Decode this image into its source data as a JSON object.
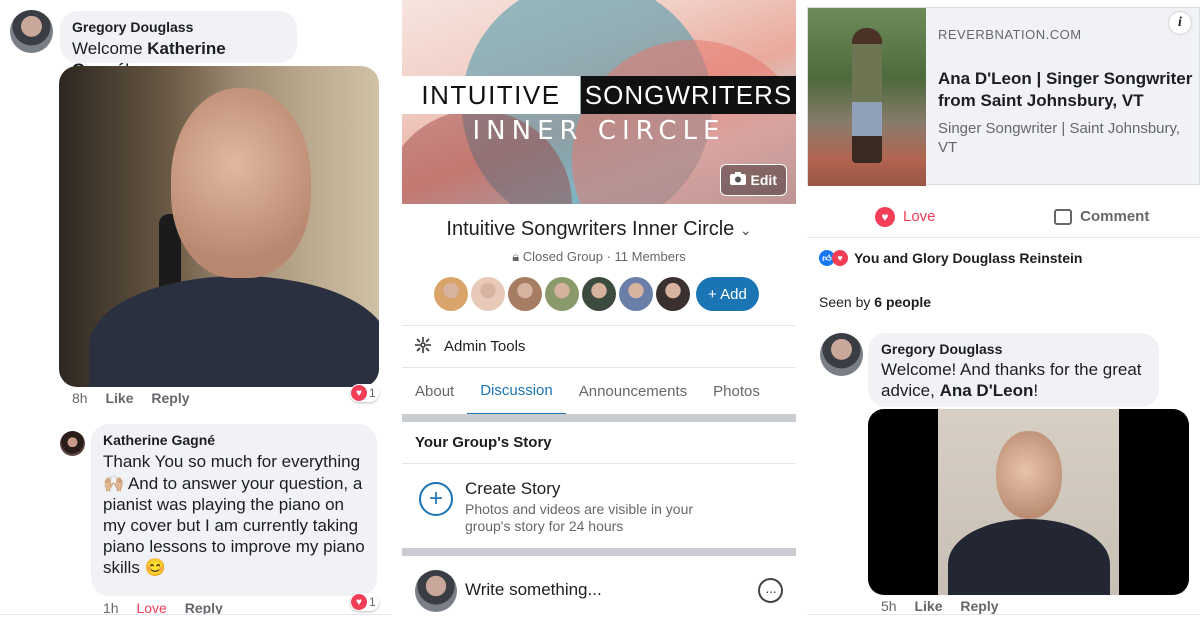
{
  "left": {
    "comment1": {
      "author": "Gregory Douglass",
      "text_prefix": "Welcome ",
      "text_bold": "Katherine Gagné",
      "text_suffix": "!"
    },
    "video_meta": {
      "time": "8h",
      "like": "Like",
      "reply": "Reply",
      "reaction_count": "1"
    },
    "comment2": {
      "author": "Katherine Gagné",
      "lines": [
        "Thank You so much for everything",
        "🙌🏼 And to answer your question, a",
        "pianist was playing the piano on",
        "my cover but I am currently taking",
        "piano lessons to improve my piano",
        "skills 😊"
      ]
    },
    "comment2_meta": {
      "time": "1h",
      "love": "Love",
      "reply": "Reply",
      "reaction_count": "1"
    }
  },
  "middle": {
    "cover": {
      "word1": "INTUITIVE",
      "word2": "SONGWRITERS",
      "line2": "INNER CIRCLE",
      "edit_label": "Edit"
    },
    "group_title": "Intuitive Songwriters Inner Circle",
    "group_sub": "Closed Group · 11 Members",
    "add_label": "+ Add",
    "member_colors": [
      "#d9a46a",
      "#e8c8b8",
      "#a67c62",
      "#8a9a6a",
      "#3d4a3e",
      "#6a7fa8",
      "#3a3030"
    ],
    "admin_tools": "Admin Tools",
    "tabs": [
      "About",
      "Discussion",
      "Announcements",
      "Photos"
    ],
    "active_tab": "Discussion",
    "story_heading": "Your Group's Story",
    "create_story": "Create Story",
    "create_story_sub": "Photos and videos are visible in your group's story for 24 hours",
    "write_placeholder": "Write something..."
  },
  "right": {
    "link": {
      "domain": "REVERBNATION.COM",
      "title": "Ana D'Leon | Singer Songwriter from Saint Johnsbury, VT",
      "desc": "Singer Songwriter | Saint Johnsbury, VT"
    },
    "actions": {
      "love": "Love",
      "comment": "Comment"
    },
    "reactions_text": "You and Glory Douglass Reinstein",
    "seen_prefix": "Seen by ",
    "seen_count": "6 people",
    "comment": {
      "author": "Gregory Douglass",
      "text_prefix": "Welcome! And thanks for the great advice, ",
      "text_bold": "Ana D'Leon",
      "text_suffix": "!"
    },
    "video_meta": {
      "time": "5h",
      "like": "Like",
      "reply": "Reply"
    }
  }
}
